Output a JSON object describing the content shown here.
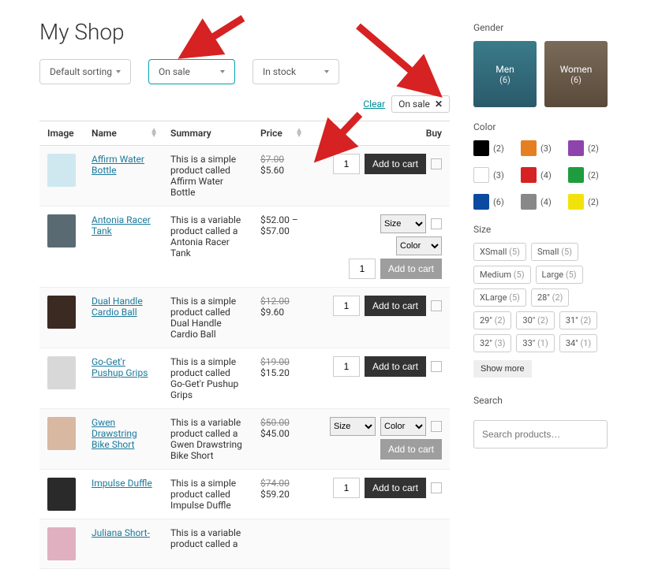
{
  "page_title": "My Shop",
  "filters": {
    "sort": "Default sorting",
    "sale": "On sale",
    "stock": "In stock"
  },
  "clear_label": "Clear",
  "active_tag": "On sale",
  "columns": {
    "image": "Image",
    "name": "Name",
    "summary": "Summary",
    "price": "Price",
    "buy": "Buy"
  },
  "qty_default": "1",
  "addcart_label": "Add to cart",
  "variant_size_label": "Size",
  "variant_color_label": "Color",
  "products": [
    {
      "name": "Affirm Water Bottle",
      "summary": "This is a simple product called Affirm Water Bottle",
      "price_old": "$7.00",
      "price": "$5.60",
      "type": "simple"
    },
    {
      "name": "Antonia Racer Tank",
      "summary": "This is a variable product called a Antonia Racer Tank",
      "price_old": "",
      "price": "$52.00 – $57.00",
      "type": "variable"
    },
    {
      "name": "Dual Handle Cardio Ball",
      "summary": "This is a simple product called Dual Handle Cardio Ball",
      "price_old": "$12.00",
      "price": "$9.60",
      "type": "simple"
    },
    {
      "name": "Go-Get'r Pushup Grips",
      "summary": "This is a simple product called Go-Get'r Pushup Grips",
      "price_old": "$19.00",
      "price": "$15.20",
      "type": "simple"
    },
    {
      "name": "Gwen Drawstring Bike Short",
      "summary": "This is a variable product called a Gwen Drawstring Bike Short",
      "price_old": "$50.00",
      "price": "$45.00",
      "type": "variable_inline"
    },
    {
      "name": "Impulse Duffle",
      "summary": "This is a simple product called Impulse Duffle",
      "price_old": "$74.00",
      "price": "$59.20",
      "type": "simple"
    },
    {
      "name": "Juliana Short-",
      "summary": "This is a variable product called a",
      "price_old": "",
      "price": "",
      "type": "cut"
    }
  ],
  "sidebar": {
    "gender_label": "Gender",
    "men": {
      "label": "Men",
      "count": "(6)"
    },
    "women": {
      "label": "Women",
      "count": "(6)"
    },
    "color_label": "Color",
    "colors": [
      {
        "hex": "#000000",
        "count": "(2)"
      },
      {
        "hex": "#e67e22",
        "count": "(3)"
      },
      {
        "hex": "#8e44ad",
        "count": "(2)"
      },
      {
        "hex": "#ffffff",
        "count": "(3)",
        "white": true
      },
      {
        "hex": "#d62222",
        "count": "(4)"
      },
      {
        "hex": "#1e9c3e",
        "count": "(2)"
      },
      {
        "hex": "#0b4aa0",
        "count": "(6)"
      },
      {
        "hex": "#888888",
        "count": "(4)"
      },
      {
        "hex": "#f2e20c",
        "count": "(2)"
      }
    ],
    "size_label": "Size",
    "sizes": [
      {
        "l": "XSmall",
        "c": "(5)"
      },
      {
        "l": "Small",
        "c": "(5)"
      },
      {
        "l": "Medium",
        "c": "(5)"
      },
      {
        "l": "Large",
        "c": "(5)"
      },
      {
        "l": "XLarge",
        "c": "(5)"
      },
      {
        "l": "28\"",
        "c": "(2)"
      },
      {
        "l": "29\"",
        "c": "(2)"
      },
      {
        "l": "30\"",
        "c": "(2)"
      },
      {
        "l": "31\"",
        "c": "(2)"
      },
      {
        "l": "32\"",
        "c": "(3)"
      },
      {
        "l": "33\"",
        "c": "(1)"
      },
      {
        "l": "34\"",
        "c": "(1)"
      }
    ],
    "show_more": "Show more",
    "search_label": "Search",
    "search_placeholder": "Search products…"
  }
}
